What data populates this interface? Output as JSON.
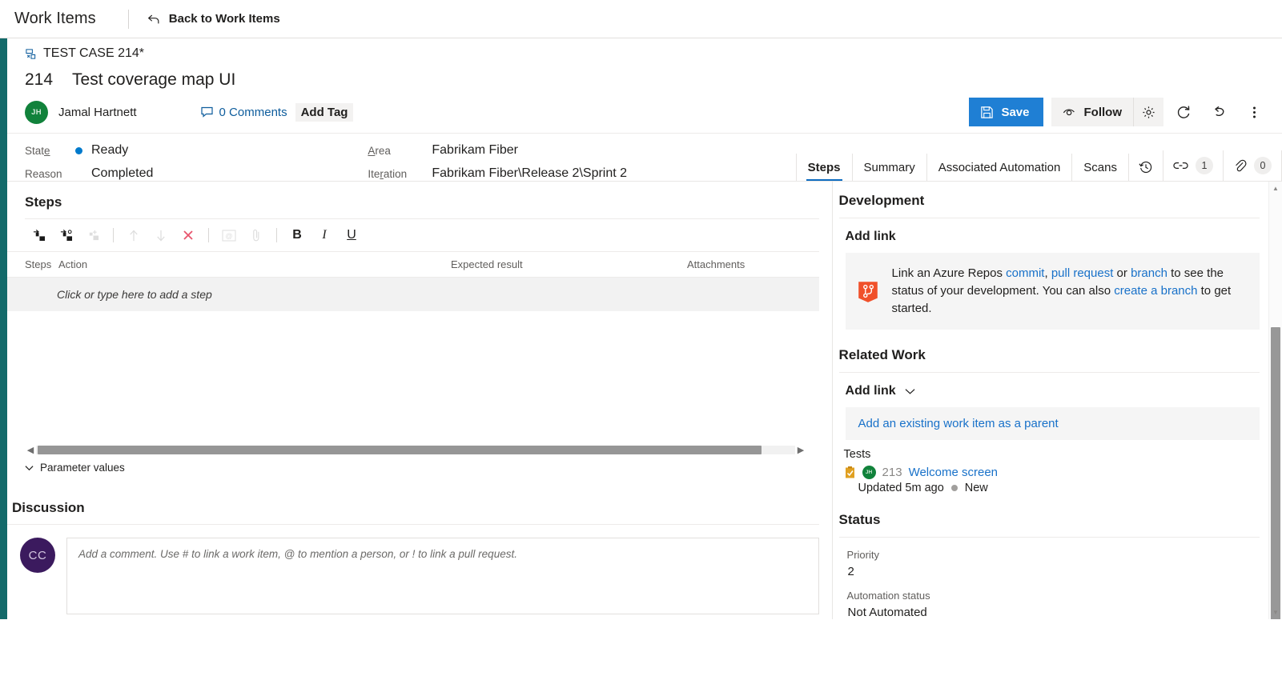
{
  "topbar": {
    "title": "Work Items",
    "back_label": "Back to Work Items",
    "back_icon": "back-arrow-icon"
  },
  "work_item": {
    "breadcrumb": "TEST CASE 214*",
    "breadcrumb_icon": "test-case-icon",
    "id": "214",
    "title": "Test coverage map UI",
    "assignee": {
      "name": "Jamal Hartnett",
      "initials": "JH",
      "avatar_color": "#11823b"
    },
    "comments_label": "0 Comments",
    "comments_icon": "comment-bubble-icon",
    "add_tag_label": "Add Tag"
  },
  "toolbar": {
    "save_label": "Save",
    "save_icon": "save-disk-icon",
    "save_color": "#1f7fd4",
    "follow_label": "Follow",
    "follow_icon": "eye-icon",
    "gear_icon": "gear-icon",
    "refresh_icon": "refresh-icon",
    "undo_icon": "undo-icon",
    "more_icon": "more-vertical-icon"
  },
  "fields": {
    "state": {
      "label": "State",
      "value": "Ready",
      "dot_color": "#007acc"
    },
    "reason": {
      "label": "Reason",
      "value": "Completed"
    },
    "area": {
      "label": "Area",
      "value": "Fabrikam Fiber"
    },
    "iteration": {
      "label": "Iteration",
      "value": "Fabrikam Fiber\\Release 2\\Sprint 2"
    }
  },
  "tabs": {
    "items": [
      {
        "label": "Steps",
        "active": true
      },
      {
        "label": "Summary",
        "active": false
      },
      {
        "label": "Associated Automation",
        "active": false
      },
      {
        "label": "Scans",
        "active": false
      }
    ],
    "history_icon": "history-icon",
    "links_icon": "link-icon",
    "links_count": "1",
    "attachments_icon": "paperclip-icon",
    "attachments_count": "0",
    "active_underline_color": "#0d6cc0"
  },
  "steps": {
    "heading": "Steps",
    "toolbar": [
      {
        "name": "insert-step-icon",
        "disabled": false
      },
      {
        "name": "insert-shared-step-icon",
        "disabled": false
      },
      {
        "name": "add-step-icon",
        "disabled": true
      },
      {
        "name": "move-up-icon",
        "disabled": true
      },
      {
        "name": "move-down-icon",
        "disabled": true
      },
      {
        "name": "delete-step-icon",
        "disabled": false
      },
      {
        "name": "mention-icon",
        "disabled": true
      },
      {
        "name": "attach-icon",
        "disabled": true
      },
      {
        "name": "bold-icon",
        "disabled": false
      },
      {
        "name": "italic-icon",
        "disabled": false
      },
      {
        "name": "underline-icon",
        "disabled": false
      }
    ],
    "columns": {
      "steps": "Steps",
      "action": "Action",
      "expected": "Expected result",
      "attachments": "Attachments"
    },
    "empty_row": "Click or type here to add a step",
    "parameter_values": "Parameter values"
  },
  "discussion": {
    "heading": "Discussion",
    "avatar_initials": "CC",
    "avatar_color": "#3b1a5e",
    "placeholder": "Add a comment. Use # to link a work item, @ to mention a person, or ! to link a pull request."
  },
  "development": {
    "heading": "Development",
    "add_link": "Add link",
    "icon": "azure-repos-icon",
    "text_1": "Link an Azure Repos ",
    "link_commit": "commit",
    "text_2": ", ",
    "link_pull_request": "pull request",
    "text_3": " or ",
    "link_branch": "branch",
    "text_4": " to see the status of your development. You can also ",
    "link_create_branch": "create a branch",
    "text_5": " to get started."
  },
  "related_work": {
    "heading": "Related Work",
    "add_link": "Add link",
    "chevron_icon": "chevron-down-icon",
    "parent_prompt": "Add an existing work item as a parent",
    "group_label": "Tests",
    "items": [
      {
        "icon": "test-case-clipboard-icon",
        "avatar_initials": "JH",
        "id": "213",
        "name": "Welcome screen",
        "updated": "Updated 5m ago",
        "state": "New"
      }
    ]
  },
  "status": {
    "heading": "Status",
    "priority_label": "Priority",
    "priority_value": "2",
    "automation_label": "Automation status",
    "automation_value": "Not Automated"
  }
}
